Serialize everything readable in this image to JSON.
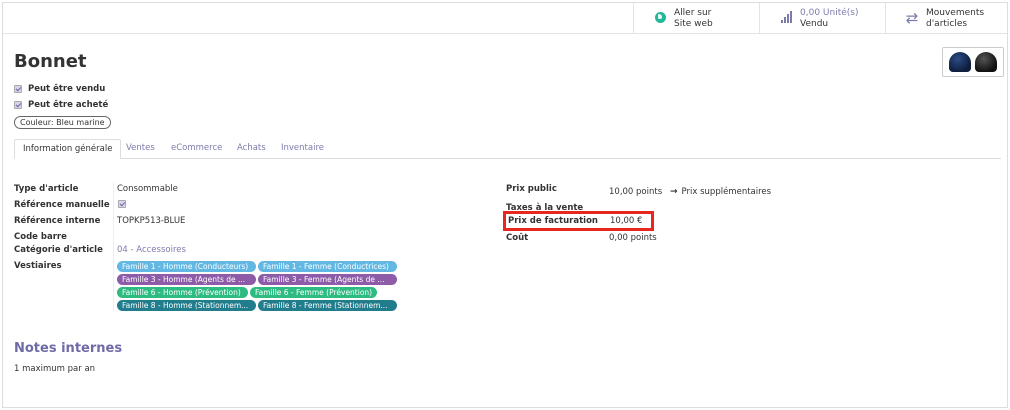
{
  "smart_buttons": {
    "website": {
      "line1": "Aller sur",
      "line2": "Site web",
      "icon": "globe-icon"
    },
    "sold": {
      "line1": "0,00 Unité(s)",
      "line2": "Vendu",
      "icon": "bar-chart-icon"
    },
    "moves": {
      "line1": "Mouvements",
      "line2": "d'articles",
      "icon": "exchange-arrows-icon"
    }
  },
  "product": {
    "name": "Bonnet",
    "can_be_sold_label": "Peut être vendu",
    "can_be_purchased_label": "Peut être acheté",
    "attribute_tag": "Couleur: Bleu marine"
  },
  "tabs": [
    {
      "label": "Information générale"
    },
    {
      "label": "Ventes"
    },
    {
      "label": "eCommerce"
    },
    {
      "label": "Achats"
    },
    {
      "label": "Inventaire"
    }
  ],
  "general": {
    "type_label": "Type d'article",
    "type_value": "Consommable",
    "manual_ref_label": "Référence manuelle",
    "internal_ref_label": "Référence interne",
    "internal_ref_value": "TOPKP513-BLUE",
    "barcode_label": "Code barre",
    "category_label": "Catégorie d'article",
    "category_value": "04 - Accessoires",
    "wardrobe_label": "Vestiaires",
    "wardrobe_tags": [
      {
        "label": "Famille 1 - Homme (Conducteurs)",
        "color": "#62b8e2"
      },
      {
        "label": "Famille 1 - Femme (Conductrices)",
        "color": "#62b8e2"
      },
      {
        "label": "Famille 3 - Homme (Agents de ...",
        "color": "#8d5ba8"
      },
      {
        "label": "Famille 3 - Femme (Agents de ...",
        "color": "#8d5ba8"
      },
      {
        "label": "Famille 6 - Homme (Prévention)",
        "color": "#2dbb82"
      },
      {
        "label": "Famille 6 - Femme (Prévention)",
        "color": "#2dbb82"
      },
      {
        "label": "Famille 8 - Homme (Stationnem...",
        "color": "#217c8c"
      },
      {
        "label": "Famille 8 - Femme (Stationnem...",
        "color": "#217c8c"
      }
    ]
  },
  "pricing": {
    "public_price_label": "Prix public",
    "public_price_value": "10,00 points",
    "extra_prices_link": "Prix supplémentaires",
    "sales_tax_label": "Taxes à la vente",
    "invoice_price_label": "Prix de facturation",
    "invoice_price_value": "10,00 €",
    "cost_label": "Coût",
    "cost_value": "0,00 points"
  },
  "notes": {
    "title": "Notes internes",
    "text": "1 maximum par an"
  },
  "colors": {
    "accent": "#7c7bad",
    "highlight_box": "#e8281e"
  }
}
